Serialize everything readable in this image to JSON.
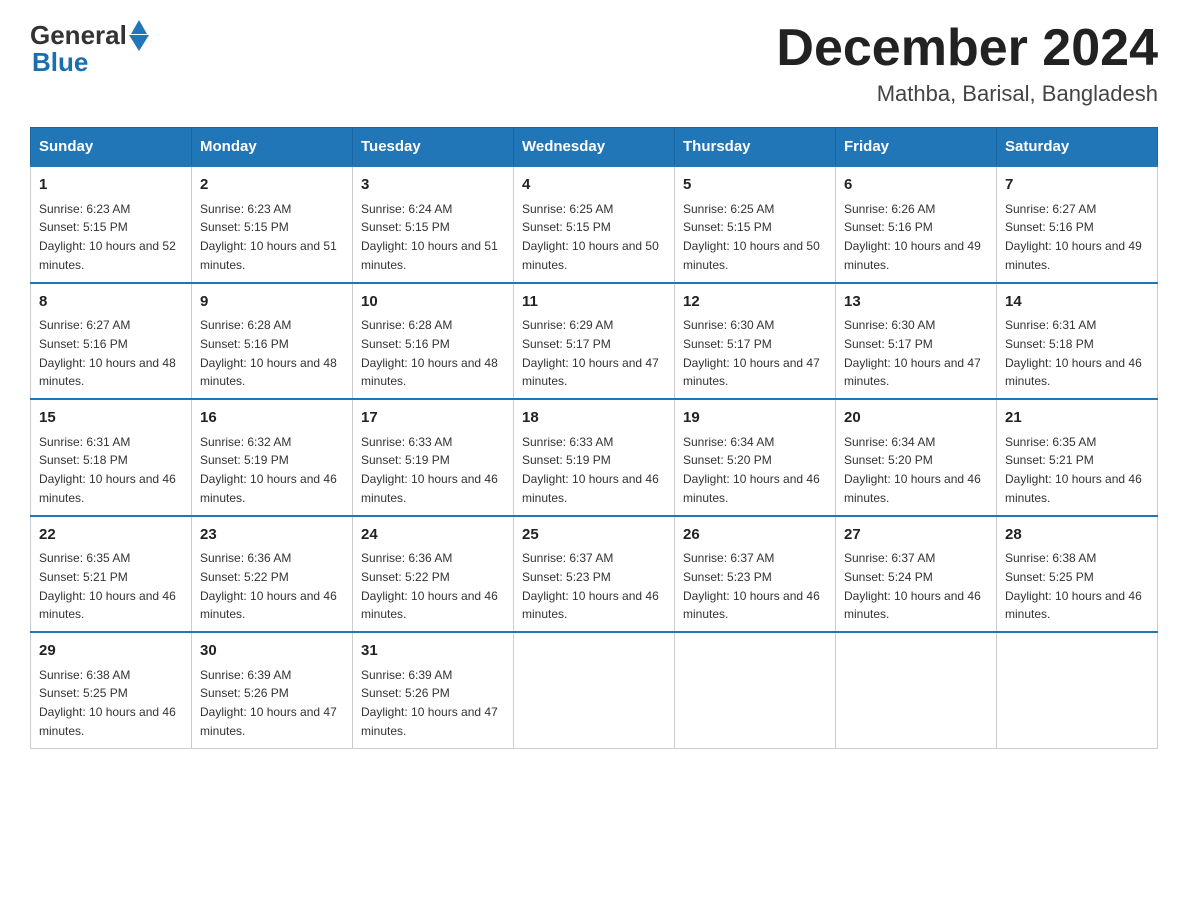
{
  "header": {
    "logo_general": "General",
    "logo_blue": "Blue",
    "month_title": "December 2024",
    "location": "Mathba, Barisal, Bangladesh"
  },
  "days_of_week": [
    "Sunday",
    "Monday",
    "Tuesday",
    "Wednesday",
    "Thursday",
    "Friday",
    "Saturday"
  ],
  "weeks": [
    [
      {
        "day": "1",
        "sunrise": "6:23 AM",
        "sunset": "5:15 PM",
        "daylight": "10 hours and 52 minutes."
      },
      {
        "day": "2",
        "sunrise": "6:23 AM",
        "sunset": "5:15 PM",
        "daylight": "10 hours and 51 minutes."
      },
      {
        "day": "3",
        "sunrise": "6:24 AM",
        "sunset": "5:15 PM",
        "daylight": "10 hours and 51 minutes."
      },
      {
        "day": "4",
        "sunrise": "6:25 AM",
        "sunset": "5:15 PM",
        "daylight": "10 hours and 50 minutes."
      },
      {
        "day": "5",
        "sunrise": "6:25 AM",
        "sunset": "5:15 PM",
        "daylight": "10 hours and 50 minutes."
      },
      {
        "day": "6",
        "sunrise": "6:26 AM",
        "sunset": "5:16 PM",
        "daylight": "10 hours and 49 minutes."
      },
      {
        "day": "7",
        "sunrise": "6:27 AM",
        "sunset": "5:16 PM",
        "daylight": "10 hours and 49 minutes."
      }
    ],
    [
      {
        "day": "8",
        "sunrise": "6:27 AM",
        "sunset": "5:16 PM",
        "daylight": "10 hours and 48 minutes."
      },
      {
        "day": "9",
        "sunrise": "6:28 AM",
        "sunset": "5:16 PM",
        "daylight": "10 hours and 48 minutes."
      },
      {
        "day": "10",
        "sunrise": "6:28 AM",
        "sunset": "5:16 PM",
        "daylight": "10 hours and 48 minutes."
      },
      {
        "day": "11",
        "sunrise": "6:29 AM",
        "sunset": "5:17 PM",
        "daylight": "10 hours and 47 minutes."
      },
      {
        "day": "12",
        "sunrise": "6:30 AM",
        "sunset": "5:17 PM",
        "daylight": "10 hours and 47 minutes."
      },
      {
        "day": "13",
        "sunrise": "6:30 AM",
        "sunset": "5:17 PM",
        "daylight": "10 hours and 47 minutes."
      },
      {
        "day": "14",
        "sunrise": "6:31 AM",
        "sunset": "5:18 PM",
        "daylight": "10 hours and 46 minutes."
      }
    ],
    [
      {
        "day": "15",
        "sunrise": "6:31 AM",
        "sunset": "5:18 PM",
        "daylight": "10 hours and 46 minutes."
      },
      {
        "day": "16",
        "sunrise": "6:32 AM",
        "sunset": "5:19 PM",
        "daylight": "10 hours and 46 minutes."
      },
      {
        "day": "17",
        "sunrise": "6:33 AM",
        "sunset": "5:19 PM",
        "daylight": "10 hours and 46 minutes."
      },
      {
        "day": "18",
        "sunrise": "6:33 AM",
        "sunset": "5:19 PM",
        "daylight": "10 hours and 46 minutes."
      },
      {
        "day": "19",
        "sunrise": "6:34 AM",
        "sunset": "5:20 PM",
        "daylight": "10 hours and 46 minutes."
      },
      {
        "day": "20",
        "sunrise": "6:34 AM",
        "sunset": "5:20 PM",
        "daylight": "10 hours and 46 minutes."
      },
      {
        "day": "21",
        "sunrise": "6:35 AM",
        "sunset": "5:21 PM",
        "daylight": "10 hours and 46 minutes."
      }
    ],
    [
      {
        "day": "22",
        "sunrise": "6:35 AM",
        "sunset": "5:21 PM",
        "daylight": "10 hours and 46 minutes."
      },
      {
        "day": "23",
        "sunrise": "6:36 AM",
        "sunset": "5:22 PM",
        "daylight": "10 hours and 46 minutes."
      },
      {
        "day": "24",
        "sunrise": "6:36 AM",
        "sunset": "5:22 PM",
        "daylight": "10 hours and 46 minutes."
      },
      {
        "day": "25",
        "sunrise": "6:37 AM",
        "sunset": "5:23 PM",
        "daylight": "10 hours and 46 minutes."
      },
      {
        "day": "26",
        "sunrise": "6:37 AM",
        "sunset": "5:23 PM",
        "daylight": "10 hours and 46 minutes."
      },
      {
        "day": "27",
        "sunrise": "6:37 AM",
        "sunset": "5:24 PM",
        "daylight": "10 hours and 46 minutes."
      },
      {
        "day": "28",
        "sunrise": "6:38 AM",
        "sunset": "5:25 PM",
        "daylight": "10 hours and 46 minutes."
      }
    ],
    [
      {
        "day": "29",
        "sunrise": "6:38 AM",
        "sunset": "5:25 PM",
        "daylight": "10 hours and 46 minutes."
      },
      {
        "day": "30",
        "sunrise": "6:39 AM",
        "sunset": "5:26 PM",
        "daylight": "10 hours and 47 minutes."
      },
      {
        "day": "31",
        "sunrise": "6:39 AM",
        "sunset": "5:26 PM",
        "daylight": "10 hours and 47 minutes."
      },
      null,
      null,
      null,
      null
    ]
  ]
}
